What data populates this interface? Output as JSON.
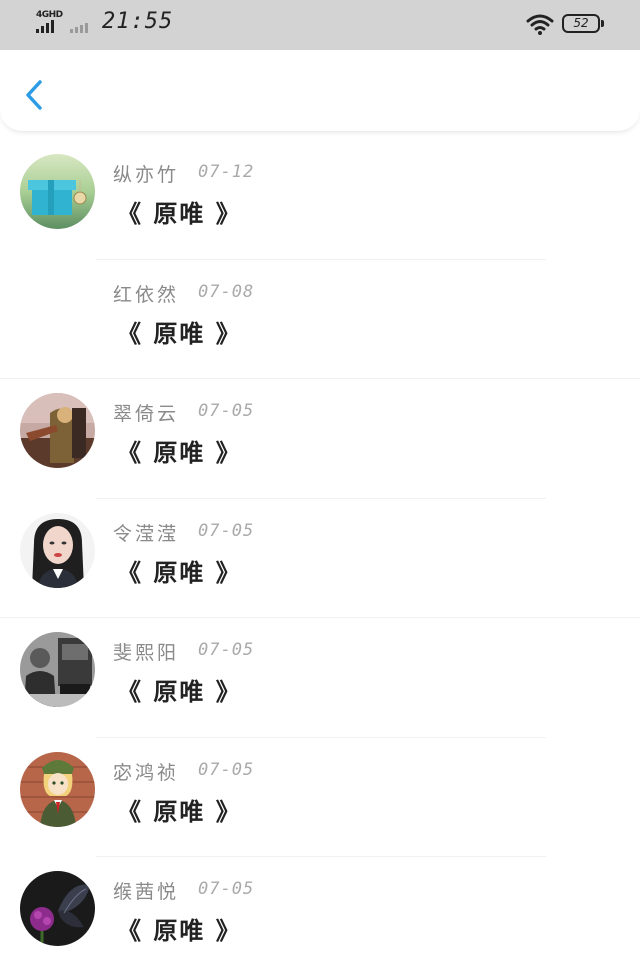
{
  "status_bar": {
    "network": "4GHD",
    "time": "21:55",
    "battery": "52"
  },
  "nav": {
    "back_icon": "chevron-left-icon",
    "accent_color": "#2d9ce6"
  },
  "comments": [
    {
      "name": "纵亦竹",
      "date": "07-12",
      "content": "《 原唯 》",
      "avatar": "gift-box"
    },
    {
      "name": "红依然",
      "date": "07-08",
      "content": "《 原唯 》",
      "avatar": "none"
    },
    {
      "name": "翠倚云",
      "date": "07-05",
      "content": "《 原唯 》",
      "avatar": "illustrated-figure"
    },
    {
      "name": "令滢滢",
      "date": "07-05",
      "content": "《 原唯 》",
      "avatar": "portrait-woman"
    },
    {
      "name": "斐熙阳",
      "date": "07-05",
      "content": "《 原唯 》",
      "avatar": "grayscale-photo"
    },
    {
      "name": "宓鸿祯",
      "date": "07-05",
      "content": "《 原唯 》",
      "avatar": "anime-boy"
    },
    {
      "name": "缑茜悦",
      "date": "07-05",
      "content": "《 原唯 》",
      "avatar": "butterfly-flower"
    }
  ]
}
